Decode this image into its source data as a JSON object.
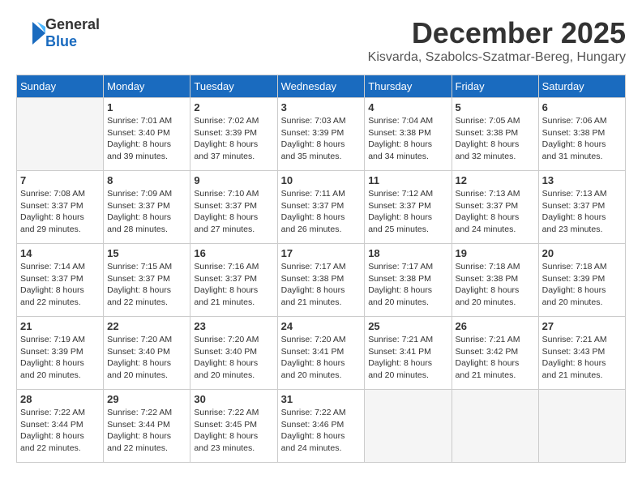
{
  "header": {
    "logo_general": "General",
    "logo_blue": "Blue",
    "title": "December 2025",
    "location": "Kisvarda, Szabolcs-Szatmar-Bereg, Hungary"
  },
  "weekdays": [
    "Sunday",
    "Monday",
    "Tuesday",
    "Wednesday",
    "Thursday",
    "Friday",
    "Saturday"
  ],
  "weeks": [
    [
      {
        "day": "",
        "sunrise": "",
        "sunset": "",
        "daylight": ""
      },
      {
        "day": "1",
        "sunrise": "7:01 AM",
        "sunset": "3:40 PM",
        "daylight": "8 hours and 39 minutes."
      },
      {
        "day": "2",
        "sunrise": "7:02 AM",
        "sunset": "3:39 PM",
        "daylight": "8 hours and 37 minutes."
      },
      {
        "day": "3",
        "sunrise": "7:03 AM",
        "sunset": "3:39 PM",
        "daylight": "8 hours and 35 minutes."
      },
      {
        "day": "4",
        "sunrise": "7:04 AM",
        "sunset": "3:38 PM",
        "daylight": "8 hours and 34 minutes."
      },
      {
        "day": "5",
        "sunrise": "7:05 AM",
        "sunset": "3:38 PM",
        "daylight": "8 hours and 32 minutes."
      },
      {
        "day": "6",
        "sunrise": "7:06 AM",
        "sunset": "3:38 PM",
        "daylight": "8 hours and 31 minutes."
      }
    ],
    [
      {
        "day": "7",
        "sunrise": "7:08 AM",
        "sunset": "3:37 PM",
        "daylight": "8 hours and 29 minutes."
      },
      {
        "day": "8",
        "sunrise": "7:09 AM",
        "sunset": "3:37 PM",
        "daylight": "8 hours and 28 minutes."
      },
      {
        "day": "9",
        "sunrise": "7:10 AM",
        "sunset": "3:37 PM",
        "daylight": "8 hours and 27 minutes."
      },
      {
        "day": "10",
        "sunrise": "7:11 AM",
        "sunset": "3:37 PM",
        "daylight": "8 hours and 26 minutes."
      },
      {
        "day": "11",
        "sunrise": "7:12 AM",
        "sunset": "3:37 PM",
        "daylight": "8 hours and 25 minutes."
      },
      {
        "day": "12",
        "sunrise": "7:13 AM",
        "sunset": "3:37 PM",
        "daylight": "8 hours and 24 minutes."
      },
      {
        "day": "13",
        "sunrise": "7:13 AM",
        "sunset": "3:37 PM",
        "daylight": "8 hours and 23 minutes."
      }
    ],
    [
      {
        "day": "14",
        "sunrise": "7:14 AM",
        "sunset": "3:37 PM",
        "daylight": "8 hours and 22 minutes."
      },
      {
        "day": "15",
        "sunrise": "7:15 AM",
        "sunset": "3:37 PM",
        "daylight": "8 hours and 22 minutes."
      },
      {
        "day": "16",
        "sunrise": "7:16 AM",
        "sunset": "3:37 PM",
        "daylight": "8 hours and 21 minutes."
      },
      {
        "day": "17",
        "sunrise": "7:17 AM",
        "sunset": "3:38 PM",
        "daylight": "8 hours and 21 minutes."
      },
      {
        "day": "18",
        "sunrise": "7:17 AM",
        "sunset": "3:38 PM",
        "daylight": "8 hours and 20 minutes."
      },
      {
        "day": "19",
        "sunrise": "7:18 AM",
        "sunset": "3:38 PM",
        "daylight": "8 hours and 20 minutes."
      },
      {
        "day": "20",
        "sunrise": "7:18 AM",
        "sunset": "3:39 PM",
        "daylight": "8 hours and 20 minutes."
      }
    ],
    [
      {
        "day": "21",
        "sunrise": "7:19 AM",
        "sunset": "3:39 PM",
        "daylight": "8 hours and 20 minutes."
      },
      {
        "day": "22",
        "sunrise": "7:20 AM",
        "sunset": "3:40 PM",
        "daylight": "8 hours and 20 minutes."
      },
      {
        "day": "23",
        "sunrise": "7:20 AM",
        "sunset": "3:40 PM",
        "daylight": "8 hours and 20 minutes."
      },
      {
        "day": "24",
        "sunrise": "7:20 AM",
        "sunset": "3:41 PM",
        "daylight": "8 hours and 20 minutes."
      },
      {
        "day": "25",
        "sunrise": "7:21 AM",
        "sunset": "3:41 PM",
        "daylight": "8 hours and 20 minutes."
      },
      {
        "day": "26",
        "sunrise": "7:21 AM",
        "sunset": "3:42 PM",
        "daylight": "8 hours and 21 minutes."
      },
      {
        "day": "27",
        "sunrise": "7:21 AM",
        "sunset": "3:43 PM",
        "daylight": "8 hours and 21 minutes."
      }
    ],
    [
      {
        "day": "28",
        "sunrise": "7:22 AM",
        "sunset": "3:44 PM",
        "daylight": "8 hours and 22 minutes."
      },
      {
        "day": "29",
        "sunrise": "7:22 AM",
        "sunset": "3:44 PM",
        "daylight": "8 hours and 22 minutes."
      },
      {
        "day": "30",
        "sunrise": "7:22 AM",
        "sunset": "3:45 PM",
        "daylight": "8 hours and 23 minutes."
      },
      {
        "day": "31",
        "sunrise": "7:22 AM",
        "sunset": "3:46 PM",
        "daylight": "8 hours and 24 minutes."
      },
      {
        "day": "",
        "sunrise": "",
        "sunset": "",
        "daylight": ""
      },
      {
        "day": "",
        "sunrise": "",
        "sunset": "",
        "daylight": ""
      },
      {
        "day": "",
        "sunrise": "",
        "sunset": "",
        "daylight": ""
      }
    ]
  ]
}
